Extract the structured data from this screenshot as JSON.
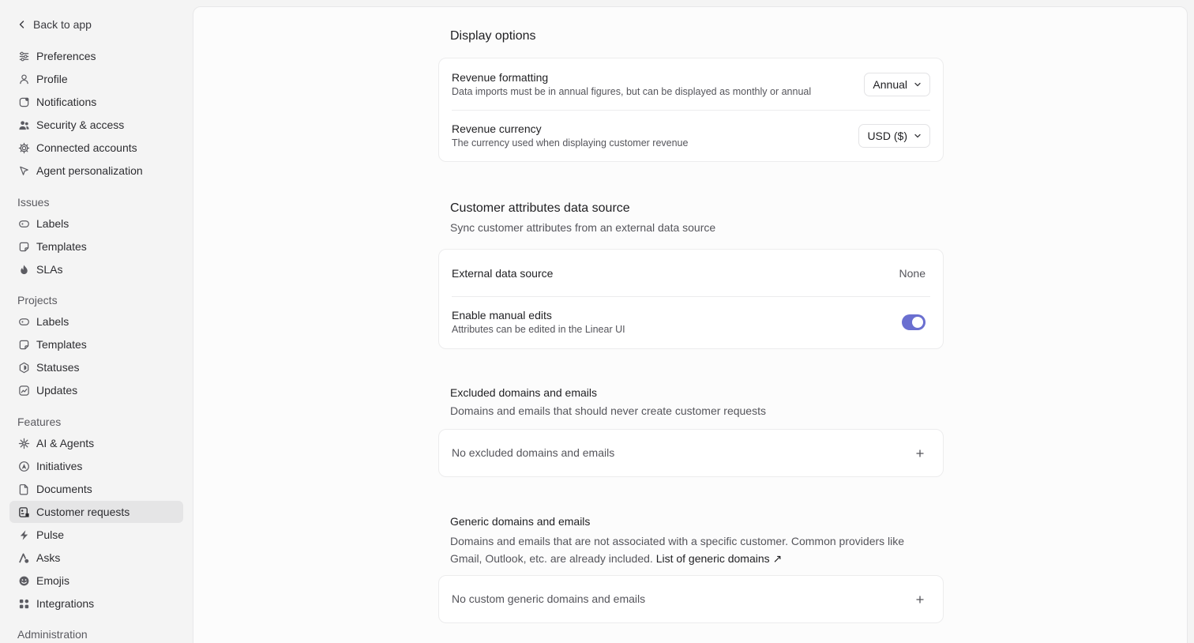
{
  "sidebar": {
    "back_label": "Back to app",
    "top_items": [
      {
        "label": "Preferences",
        "icon": "sliders-icon"
      },
      {
        "label": "Profile",
        "icon": "person-icon"
      },
      {
        "label": "Notifications",
        "icon": "notification-icon"
      },
      {
        "label": "Security & access",
        "icon": "people-icon"
      },
      {
        "label": "Connected accounts",
        "icon": "gear-icon"
      },
      {
        "label": "Agent personalization",
        "icon": "pointer-icon"
      }
    ],
    "sections": [
      {
        "title": "Issues",
        "items": [
          {
            "label": "Labels",
            "icon": "tag-icon"
          },
          {
            "label": "Templates",
            "icon": "template-icon"
          },
          {
            "label": "SLAs",
            "icon": "flame-icon"
          }
        ]
      },
      {
        "title": "Projects",
        "items": [
          {
            "label": "Labels",
            "icon": "tag-icon"
          },
          {
            "label": "Templates",
            "icon": "template-icon"
          },
          {
            "label": "Statuses",
            "icon": "hexagon-icon"
          },
          {
            "label": "Updates",
            "icon": "chart-icon"
          }
        ]
      },
      {
        "title": "Features",
        "items": [
          {
            "label": "AI & Agents",
            "icon": "sparkle-icon"
          },
          {
            "label": "Initiatives",
            "icon": "initiative-icon"
          },
          {
            "label": "Documents",
            "icon": "document-icon"
          },
          {
            "label": "Customer requests",
            "icon": "customer-icon"
          },
          {
            "label": "Pulse",
            "icon": "pulse-icon"
          },
          {
            "label": "Asks",
            "icon": "asks-icon"
          },
          {
            "label": "Emojis",
            "icon": "emoji-icon"
          },
          {
            "label": "Integrations",
            "icon": "grid-icon"
          }
        ]
      },
      {
        "title": "Administration",
        "items": []
      }
    ],
    "active_item": "Customer requests"
  },
  "display_options": {
    "title": "Display options",
    "revenue_formatting": {
      "title": "Revenue formatting",
      "description": "Data imports must be in annual figures, but can be displayed as monthly or annual",
      "value": "Annual"
    },
    "revenue_currency": {
      "title": "Revenue currency",
      "description": "The currency used when displaying customer revenue",
      "value": "USD ($)"
    }
  },
  "attributes_source": {
    "title": "Customer attributes data source",
    "description": "Sync customer attributes from an external data source",
    "external_source": {
      "title": "External data source",
      "value": "None"
    },
    "manual_edits": {
      "title": "Enable manual edits",
      "description": "Attributes can be edited in the Linear UI",
      "enabled": true
    }
  },
  "excluded": {
    "title": "Excluded domains and emails",
    "description": "Domains and emails that should never create customer requests",
    "empty_text": "No excluded domains and emails"
  },
  "generic": {
    "title": "Generic domains and emails",
    "description": "Domains and emails that are not associated with a specific customer. Common providers like Gmail, Outlook, etc. are already included.",
    "link_text": "List of generic domains ↗",
    "empty_text": "No custom generic domains and emails"
  },
  "colors": {
    "toggle_on": "#6a6fd0",
    "active_bg": "#e5e5e6"
  }
}
